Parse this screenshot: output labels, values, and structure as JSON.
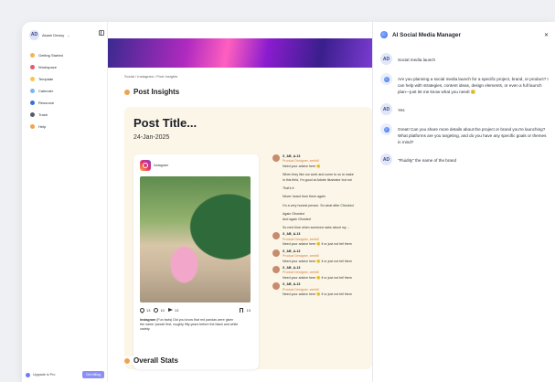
{
  "sidebar": {
    "workspace_initials": "AD",
    "workspace_name": "Akash Dewsy",
    "items": [
      {
        "label": "Getting Started",
        "color": "#f2b35a"
      },
      {
        "label": "Workspace",
        "color": "#e45b6b"
      },
      {
        "label": "Template",
        "color": "#f2c94c"
      },
      {
        "label": "Calender",
        "color": "#7bb6f0"
      },
      {
        "label": "Resource",
        "color": "#3b6fd6"
      },
      {
        "label": "Trash",
        "color": "#555b6a"
      },
      {
        "label": "Help",
        "color": "#f2a250"
      }
    ],
    "trial_text": "Upgrade to Pro",
    "trial_button": "Get billing"
  },
  "main": {
    "breadcrumb": "Social  /  Instagram  /  Post Insights",
    "insights_title": "Post Insights",
    "post_title": "Post Title...",
    "post_date": "24-Jan-2025",
    "ig_name": "Instagram",
    "likes": "13",
    "comments_count": "10",
    "shares": "13",
    "saves": "13",
    "caption_handle": "Instagram",
    "caption_text": "(Fun facts) Did you know that red pandas were given",
    "caption_line2": "the name 'panda' first, roughly fifty years before the black and white",
    "caption_line3": "variety.",
    "comments": [
      {
        "name": "X_AB_A-13",
        "role": "Product Designer, zenhill",
        "lines": [
          "Need your advice here 🙂",
          "When they like our work and come to us to make",
          "in this field, I'm good at Adobe Illustrator but not",
          "That's it",
          "Never heard from them again",
          "I'm a very honest person. So what after Checked",
          "Again Ghosted",
          "And again Ghosted",
          "So next time when someone asks about my ..."
        ]
      },
      {
        "name": "X_AB_A-13",
        "role": "Product Designer, zenhill",
        "lines": [
          "Need your advice here 🙂 if or just not tell them"
        ]
      },
      {
        "name": "X_AB_A-13",
        "role": "Product Designer, zenhill",
        "lines": [
          "Need your advice here 🙂 if or just not tell them"
        ]
      },
      {
        "name": "X_AB_A-13",
        "role": "Product Designer, zenhill",
        "lines": [
          "Need your advice here 🙂 if or just not tell them"
        ]
      },
      {
        "name": "X_AB_A-13",
        "role": "Product Designer, zenhill",
        "lines": [
          "Need your advice here 🙂 if or just not tell them"
        ]
      }
    ],
    "overall_title": "Overall Stats"
  },
  "ai": {
    "title": "AI Social Media Manager",
    "messages": [
      {
        "role": "user",
        "initials": "AD",
        "text": "Social media launch"
      },
      {
        "role": "ai",
        "text": "Are you planning a social media launch for a specific project, brand, or product? I can help with strategies, content ideas, design elements, or even a full launch plan—just let me know what you need! 😊"
      },
      {
        "role": "user",
        "initials": "AD",
        "text": "Yes"
      },
      {
        "role": "ai",
        "text": "Great! Can you share more details about the project or brand you're launching? What platforms are you targeting, and do you have any specific goals or themes in mind?"
      },
      {
        "role": "user",
        "initials": "AD",
        "text": "\"Fluidity\" the name of the brand"
      }
    ]
  }
}
